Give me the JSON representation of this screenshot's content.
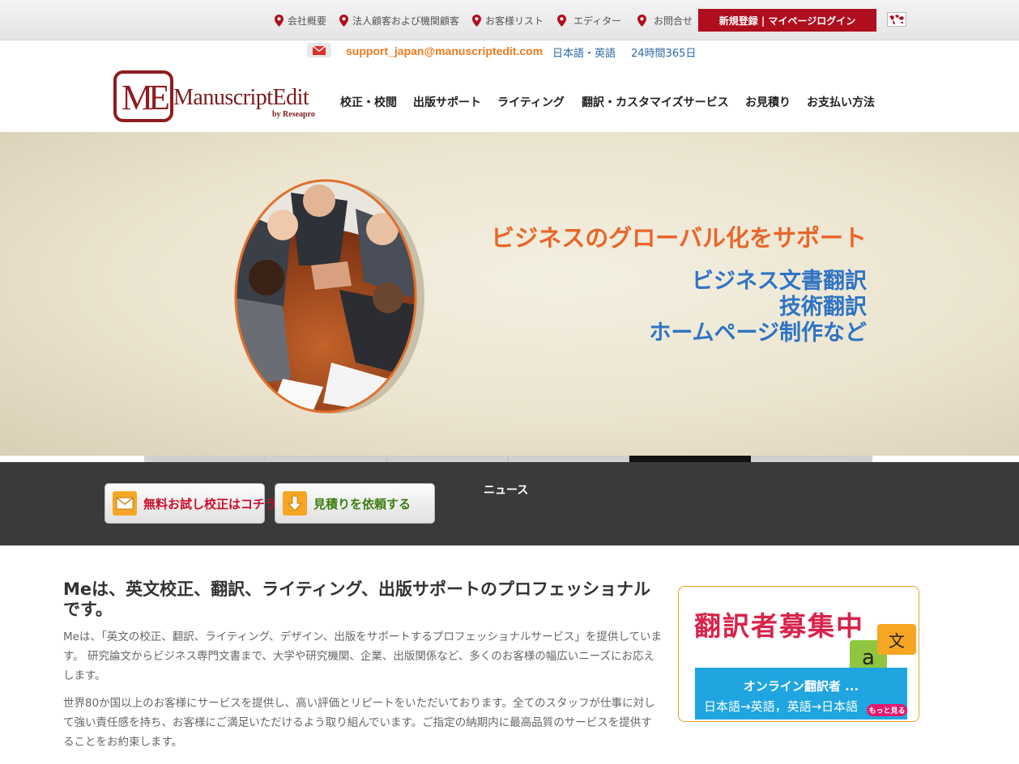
{
  "topbar": {
    "links": [
      {
        "label": "会社概要"
      },
      {
        "label": "法人顧客および機関顧客"
      },
      {
        "label": "お客様リスト"
      },
      {
        "label": "エディター"
      },
      {
        "label": "お問合せ"
      }
    ],
    "register_button": "新規登録 | マイページログイン",
    "pin_color": "#b00d1d"
  },
  "contact": {
    "email": "support_japan@manuscriptedit.com",
    "languages": "日本語・英語",
    "hours": "24時間365日"
  },
  "logo": {
    "mark": "ME",
    "name": "ManuscriptEdit",
    "byline": "by Reseapro"
  },
  "nav": {
    "items": [
      {
        "label": "校正・校閲"
      },
      {
        "label": "出版サポート"
      },
      {
        "label": "ライティング"
      },
      {
        "label": "翻訳・カスタマイズサービス"
      },
      {
        "label": "お見積り"
      },
      {
        "label": "お支払い方法"
      }
    ]
  },
  "hero": {
    "headline": "ビジネスのグローバル化をサポート",
    "lines": [
      "ビジネス文書翻訳",
      "技術翻訳",
      "ホームページ制作など"
    ],
    "headline_color": "#e8662a",
    "lines_color": "#2e74c4",
    "slider_active_index": 4,
    "slider_count": 6
  },
  "actions": {
    "free_trial": "無料お試し校正はコチラ",
    "quote": "見積りを依頼する",
    "news": "ニュース"
  },
  "intro": {
    "title": "Meは、英文校正、翻訳、ライティング、出版サポートのプロフェッショナルです。",
    "p1": "Meは、「英文の校正、翻訳、ライティング、デザイン、出版をサポートするプロフェッショナルサービス」を提供しています。 研究論文からビジネス専門文書まで、大学や研究機関、企業、出版関係など、多くのお客様の幅広いニーズにお応えします。",
    "p2": "世界80か国以上のお客様にサービスを提供し、高い評価とリピートをいただいております。全てのスタッフが仕事に対して強い責任感を持ち、お客様にご満足いただけるよう取り組んでいます。ご指定の納期内に最高品質のサービスを提供することをお約束します。"
  },
  "recruit": {
    "title": "翻訳者募集中",
    "bubble_a": "a",
    "bubble_b": "文",
    "subtitle": "オンライン翻訳者 ...",
    "directions": "日本語→英語，英語→日本語",
    "more": "もっと見る"
  }
}
